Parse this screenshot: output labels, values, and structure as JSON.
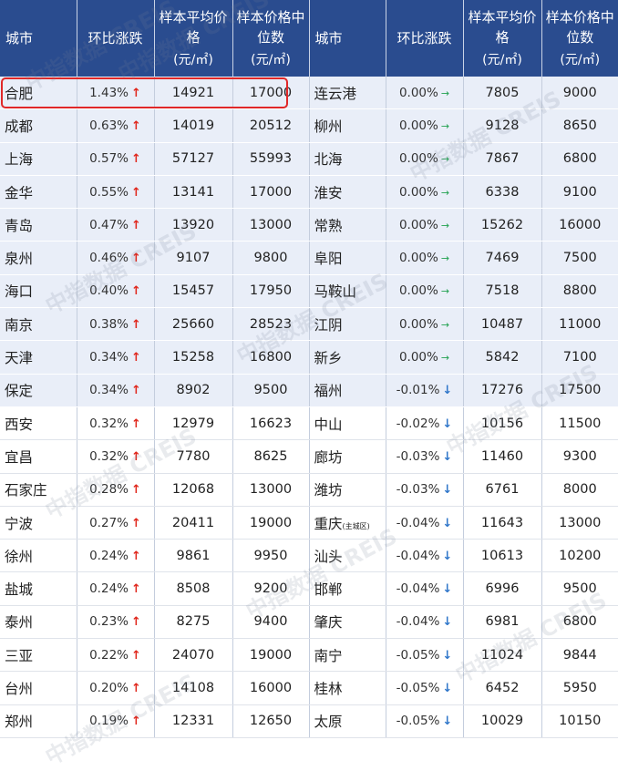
{
  "headers": {
    "city": "城市",
    "change": "环比涨跌",
    "avg_price": "样本平均价格",
    "median_price": "样本价格中位数",
    "unit": "(元/㎡)"
  },
  "rows": [
    {
      "l_city": "合肥",
      "l_change": "1.43%",
      "l_dir": "up",
      "l_avg": "14921",
      "l_med": "17000",
      "r_city": "连云港",
      "r_change": "0.00%",
      "r_dir": "flat",
      "r_avg": "7805",
      "r_med": "9000"
    },
    {
      "l_city": "成都",
      "l_change": "0.63%",
      "l_dir": "up",
      "l_avg": "14019",
      "l_med": "20512",
      "r_city": "柳州",
      "r_change": "0.00%",
      "r_dir": "flat",
      "r_avg": "9128",
      "r_med": "8650"
    },
    {
      "l_city": "上海",
      "l_change": "0.57%",
      "l_dir": "up",
      "l_avg": "57127",
      "l_med": "55993",
      "r_city": "北海",
      "r_change": "0.00%",
      "r_dir": "flat",
      "r_avg": "7867",
      "r_med": "6800"
    },
    {
      "l_city": "金华",
      "l_change": "0.55%",
      "l_dir": "up",
      "l_avg": "13141",
      "l_med": "17000",
      "r_city": "淮安",
      "r_change": "0.00%",
      "r_dir": "flat",
      "r_avg": "6338",
      "r_med": "9100"
    },
    {
      "l_city": "青岛",
      "l_change": "0.47%",
      "l_dir": "up",
      "l_avg": "13920",
      "l_med": "13000",
      "r_city": "常熟",
      "r_change": "0.00%",
      "r_dir": "flat",
      "r_avg": "15262",
      "r_med": "16000"
    },
    {
      "l_city": "泉州",
      "l_change": "0.46%",
      "l_dir": "up",
      "l_avg": "9107",
      "l_med": "9800",
      "r_city": "阜阳",
      "r_change": "0.00%",
      "r_dir": "flat",
      "r_avg": "7469",
      "r_med": "7500"
    },
    {
      "l_city": "海口",
      "l_change": "0.40%",
      "l_dir": "up",
      "l_avg": "15457",
      "l_med": "17950",
      "r_city": "马鞍山",
      "r_change": "0.00%",
      "r_dir": "flat",
      "r_avg": "7518",
      "r_med": "8800"
    },
    {
      "l_city": "南京",
      "l_change": "0.38%",
      "l_dir": "up",
      "l_avg": "25660",
      "l_med": "28523",
      "r_city": "江阴",
      "r_change": "0.00%",
      "r_dir": "flat",
      "r_avg": "10487",
      "r_med": "11000"
    },
    {
      "l_city": "天津",
      "l_change": "0.34%",
      "l_dir": "up",
      "l_avg": "15258",
      "l_med": "16800",
      "r_city": "新乡",
      "r_change": "0.00%",
      "r_dir": "flat",
      "r_avg": "5842",
      "r_med": "7100"
    },
    {
      "l_city": "保定",
      "l_change": "0.34%",
      "l_dir": "up",
      "l_avg": "8902",
      "l_med": "9500",
      "r_city": "福州",
      "r_change": "-0.01%",
      "r_dir": "down",
      "r_avg": "17276",
      "r_med": "17500"
    },
    {
      "l_city": "西安",
      "l_change": "0.32%",
      "l_dir": "up",
      "l_avg": "12979",
      "l_med": "16623",
      "r_city": "中山",
      "r_change": "-0.02%",
      "r_dir": "down",
      "r_avg": "10156",
      "r_med": "11500"
    },
    {
      "l_city": "宜昌",
      "l_change": "0.32%",
      "l_dir": "up",
      "l_avg": "7780",
      "l_med": "8625",
      "r_city": "廊坊",
      "r_change": "-0.03%",
      "r_dir": "down",
      "r_avg": "11460",
      "r_med": "9300"
    },
    {
      "l_city": "石家庄",
      "l_change": "0.28%",
      "l_dir": "up",
      "l_avg": "12068",
      "l_med": "13000",
      "r_city": "潍坊",
      "r_change": "-0.03%",
      "r_dir": "down",
      "r_avg": "6761",
      "r_med": "8000"
    },
    {
      "l_city": "宁波",
      "l_change": "0.27%",
      "l_dir": "up",
      "l_avg": "20411",
      "l_med": "19000",
      "r_city": "重庆",
      "r_city_note": "(主城区)",
      "r_change": "-0.04%",
      "r_dir": "down",
      "r_avg": "11643",
      "r_med": "13000"
    },
    {
      "l_city": "徐州",
      "l_change": "0.24%",
      "l_dir": "up",
      "l_avg": "9861",
      "l_med": "9950",
      "r_city": "汕头",
      "r_change": "-0.04%",
      "r_dir": "down",
      "r_avg": "10613",
      "r_med": "10200"
    },
    {
      "l_city": "盐城",
      "l_change": "0.24%",
      "l_dir": "up",
      "l_avg": "8508",
      "l_med": "9200",
      "r_city": "邯郸",
      "r_change": "-0.04%",
      "r_dir": "down",
      "r_avg": "6996",
      "r_med": "9500"
    },
    {
      "l_city": "泰州",
      "l_change": "0.23%",
      "l_dir": "up",
      "l_avg": "8275",
      "l_med": "9400",
      "r_city": "肇庆",
      "r_change": "-0.04%",
      "r_dir": "down",
      "r_avg": "6981",
      "r_med": "6800"
    },
    {
      "l_city": "三亚",
      "l_change": "0.22%",
      "l_dir": "up",
      "l_avg": "24070",
      "l_med": "19000",
      "r_city": "南宁",
      "r_change": "-0.05%",
      "r_dir": "down",
      "r_avg": "11024",
      "r_med": "9844"
    },
    {
      "l_city": "台州",
      "l_change": "0.20%",
      "l_dir": "up",
      "l_avg": "14108",
      "l_med": "16000",
      "r_city": "桂林",
      "r_change": "-0.05%",
      "r_dir": "down",
      "r_avg": "6452",
      "r_med": "5950"
    },
    {
      "l_city": "郑州",
      "l_change": "0.19%",
      "l_dir": "up",
      "l_avg": "12331",
      "l_med": "12650",
      "r_city": "太原",
      "r_change": "-0.05%",
      "r_dir": "down",
      "r_avg": "10029",
      "r_med": "10150"
    }
  ],
  "arrows": {
    "up": "↑",
    "flat": "→",
    "down": "↓"
  },
  "colors": {
    "header_bg": "#2a4c8f",
    "shaded_row": "#e9eef8",
    "up": "#e0261b",
    "flat": "#22a150",
    "down": "#2f76c9",
    "highlight": "#e02828"
  },
  "highlighted_row": 0,
  "watermark": {
    "cn": "中指数据",
    "en": "CREIS"
  }
}
